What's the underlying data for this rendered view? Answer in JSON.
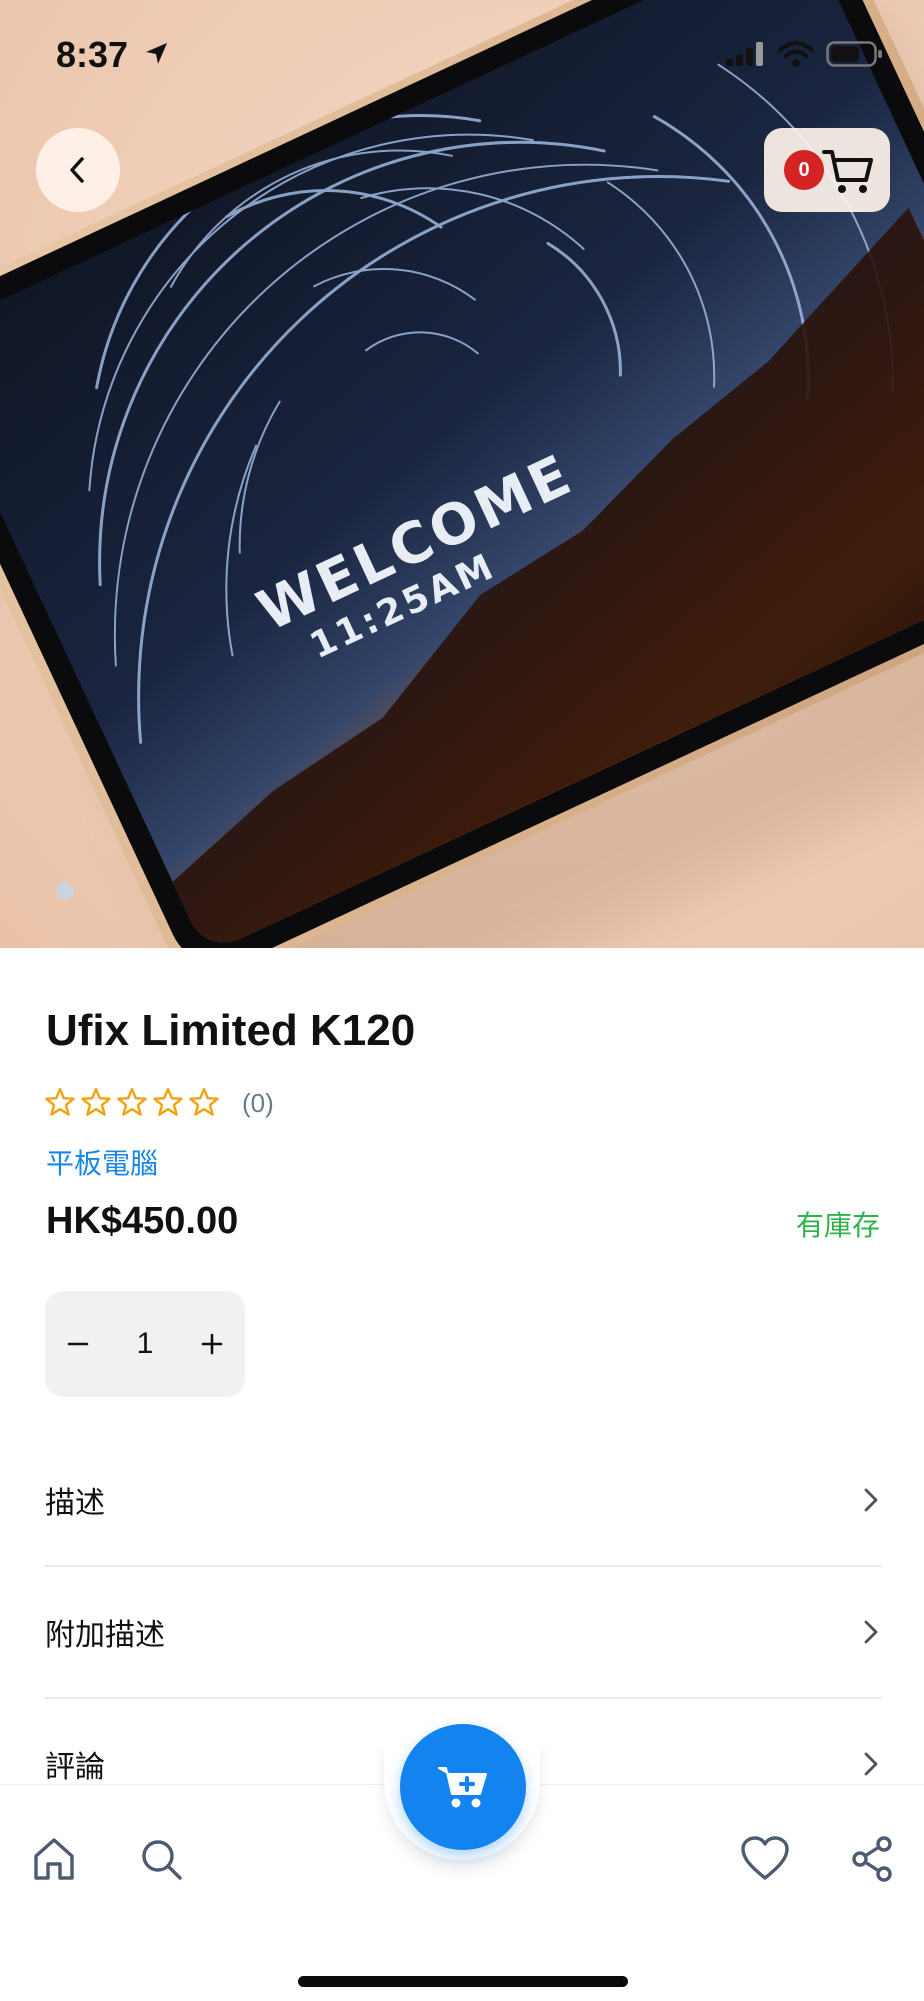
{
  "status_bar": {
    "time": "8:37",
    "icons": [
      "location-arrow-icon",
      "signal-icon",
      "wifi-icon",
      "battery-icon"
    ]
  },
  "hero": {
    "screen_text_line1": "WELCOME",
    "screen_text_line2": "11:25AM",
    "carousel_total_dots": 1,
    "carousel_active_index": 0
  },
  "header": {
    "back_icon": "chevron-left-icon",
    "cart_count": "0",
    "cart_icon": "cart-icon"
  },
  "product": {
    "title": "Ufix Limited K120",
    "rating": 0,
    "rating_max": 5,
    "rating_count": "(0)",
    "category": "平板電腦",
    "price": "HK$450.00",
    "stock_status": "有庫存",
    "quantity": "1"
  },
  "sections": [
    {
      "label": "描述"
    },
    {
      "label": "附加描述"
    },
    {
      "label": "評論"
    }
  ],
  "bottom_nav": {
    "items": [
      "home-icon",
      "search-icon",
      "add-to-cart-icon",
      "heart-icon",
      "share-icon"
    ]
  },
  "colors": {
    "accent": "#1383ef",
    "link": "#1a86e8",
    "in_stock": "#2fb34b",
    "star": "#f2a20c",
    "badge": "#d32323"
  }
}
